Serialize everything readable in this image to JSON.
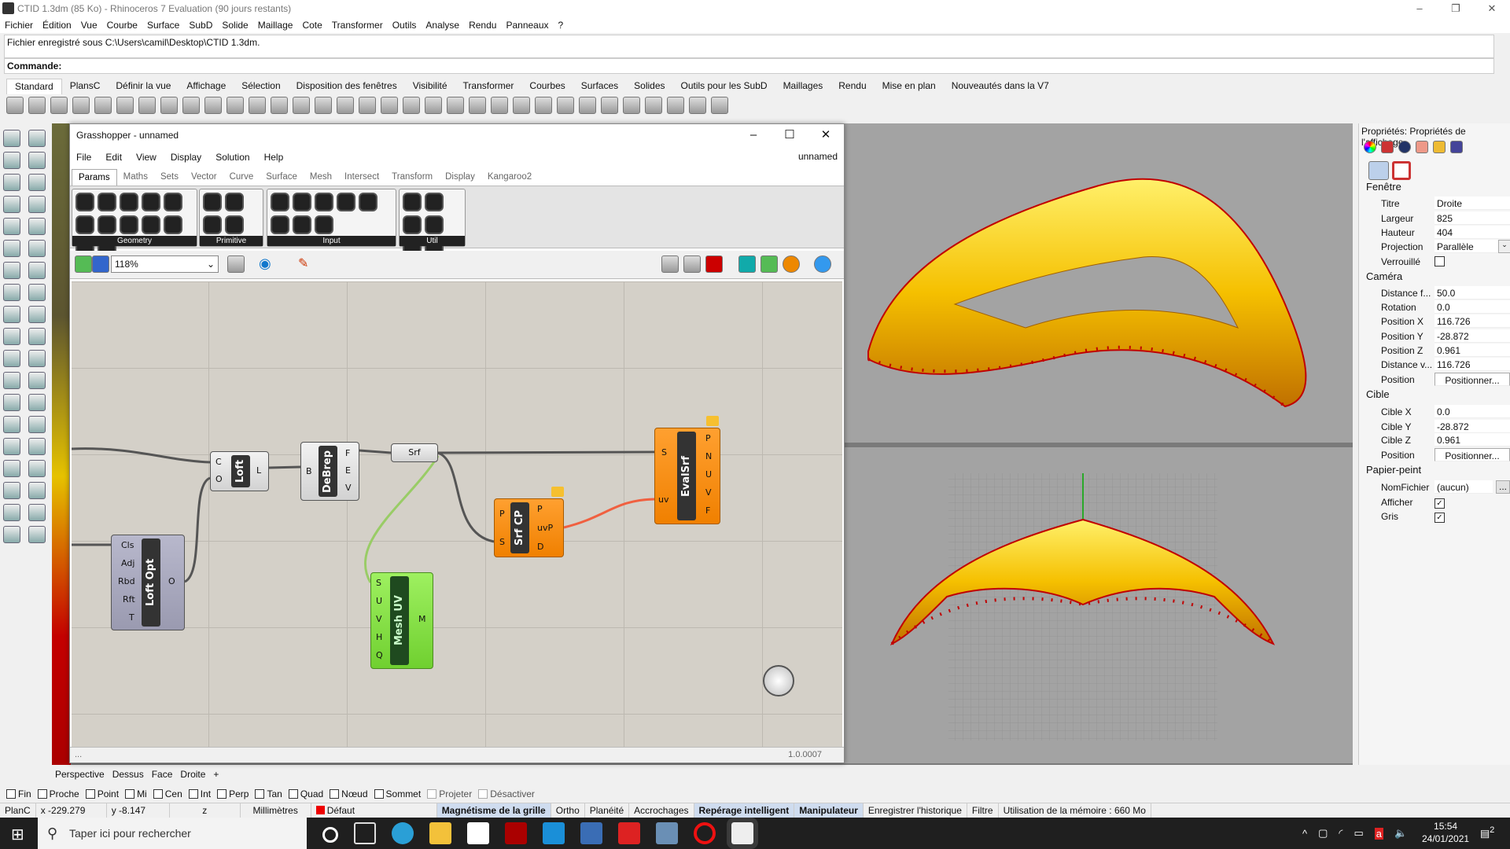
{
  "window": {
    "title": "CTID 1.3dm (85 Ko) - Rhinoceros 7 Evaluation (90 jours restants)"
  },
  "menu": [
    "Fichier",
    "Édition",
    "Vue",
    "Courbe",
    "Surface",
    "SubD",
    "Solide",
    "Maillage",
    "Cote",
    "Transformer",
    "Outils",
    "Analyse",
    "Rendu",
    "Panneaux",
    "?"
  ],
  "command": {
    "history": "Fichier enregistré sous C:\\Users\\camil\\Desktop\\CTID 1.3dm.",
    "prompt": "Commande:"
  },
  "toolbar_tabs": [
    "Standard",
    "PlansC",
    "Définir la vue",
    "Affichage",
    "Sélection",
    "Disposition des fenêtres",
    "Visibilité",
    "Transformer",
    "Courbes",
    "Surfaces",
    "Solides",
    "Outils pour les SubD",
    "Maillages",
    "Rendu",
    "Mise en plan",
    "Nouveautés dans la V7"
  ],
  "grasshopper": {
    "title": "Grasshopper - unnamed",
    "doc_name": "unnamed",
    "menu": [
      "File",
      "Edit",
      "View",
      "Display",
      "Solution",
      "Help"
    ],
    "tabs": [
      "Params",
      "Maths",
      "Sets",
      "Vector",
      "Curve",
      "Surface",
      "Mesh",
      "Intersect",
      "Transform",
      "Display",
      "Kangaroo2"
    ],
    "groups": [
      "Geometry",
      "Primitive",
      "Input",
      "Util"
    ],
    "zoom": "118%",
    "status_left": "...",
    "version": "1.0.0007",
    "nodes": {
      "loft": {
        "name": "Loft",
        "inputs": [
          "C",
          "O"
        ],
        "outputs": [
          "L"
        ]
      },
      "debrep": {
        "name": "DeBrep",
        "inputs": [
          "B"
        ],
        "outputs": [
          "F",
          "E",
          "V"
        ]
      },
      "srf": {
        "name": "Srf"
      },
      "evalsrf": {
        "name": "EvalSrf",
        "inputs": [
          "S",
          "uv"
        ],
        "outputs": [
          "P",
          "N",
          "U",
          "V",
          "F"
        ]
      },
      "srfcp": {
        "name": "Srf CP",
        "inputs": [
          "P",
          "S"
        ],
        "outputs": [
          "P",
          "uvP",
          "D"
        ]
      },
      "loftopt": {
        "name": "Loft Opt",
        "inputs": [
          "Cls",
          "Adj",
          "Rbd",
          "Rft",
          "T"
        ],
        "outputs": [
          "O"
        ]
      },
      "meshuv": {
        "name": "Mesh UV",
        "inputs": [
          "S",
          "U",
          "V",
          "H",
          "Q"
        ],
        "outputs": [
          "M"
        ]
      }
    }
  },
  "properties": {
    "title": "Propriétés: Propriétés de l'affichage",
    "fenetre": {
      "header": "Fenêtre",
      "titre_label": "Titre",
      "titre": "Droite",
      "largeur_label": "Largeur",
      "largeur": "825",
      "hauteur_label": "Hauteur",
      "hauteur": "404",
      "projection_label": "Projection",
      "projection": "Parallèle",
      "verrouille_label": "Verrouillé",
      "verrouille": false
    },
    "camera": {
      "header": "Caméra",
      "dist_focale_label": "Distance f...",
      "dist_focale": "50.0",
      "rotation_label": "Rotation",
      "rotation": "0.0",
      "px_label": "Position X",
      "px": "116.726",
      "py_label": "Position Y",
      "py": "-28.872",
      "pz_label": "Position Z",
      "pz": "0.961",
      "dist_v_label": "Distance v...",
      "dist_v": "116.726",
      "position_label": "Position",
      "position_btn": "Positionner..."
    },
    "cible": {
      "header": "Cible",
      "x_label": "Cible X",
      "x": "0.0",
      "y_label": "Cible Y",
      "y": "-28.872",
      "z_label": "Cible Z",
      "z": "0.961",
      "position_label": "Position",
      "position_btn": "Positionner..."
    },
    "papier": {
      "header": "Papier-peint",
      "fichier_label": "NomFichier",
      "fichier": "(aucun)",
      "browse": "...",
      "afficher_label": "Afficher",
      "afficher": true,
      "gris_label": "Gris",
      "gris": true
    }
  },
  "viewport_tabs": [
    "Perspective",
    "Dessus",
    "Face",
    "Droite",
    "+"
  ],
  "osnaps": [
    {
      "label": "Fin"
    },
    {
      "label": "Proche"
    },
    {
      "label": "Point"
    },
    {
      "label": "Mi"
    },
    {
      "label": "Cen"
    },
    {
      "label": "Int"
    },
    {
      "label": "Perp"
    },
    {
      "label": "Tan"
    },
    {
      "label": "Quad"
    },
    {
      "label": "Nœud"
    },
    {
      "label": "Sommet"
    },
    {
      "label": "Projeter",
      "disabled": true
    },
    {
      "label": "Désactiver",
      "disabled": true
    }
  ],
  "status": {
    "plane": "PlanC",
    "x": "x -229.279",
    "y": "y -8.147",
    "z": "z",
    "units": "Millimètres",
    "layer": "Défaut",
    "layer_color": "#e00000",
    "toggles": [
      {
        "label": "Magnétisme de la grille",
        "on": true
      },
      {
        "label": "Ortho"
      },
      {
        "label": "Planéité"
      },
      {
        "label": "Accrochages"
      },
      {
        "label": "Repérage intelligent",
        "on": true
      },
      {
        "label": "Manipulateur",
        "on": true
      },
      {
        "label": "Enregistrer l'historique"
      },
      {
        "label": "Filtre"
      }
    ],
    "memory": "Utilisation de la mémoire : 660 Mo"
  },
  "taskbar": {
    "search_placeholder": "Taper ici pour rechercher",
    "time": "15:54",
    "date": "24/01/2021",
    "notifications": "2"
  },
  "colors": {
    "surface": "#f5c800",
    "edges": "#c00000",
    "gh_orange": "#f59020",
    "gh_green": "#80e040"
  }
}
